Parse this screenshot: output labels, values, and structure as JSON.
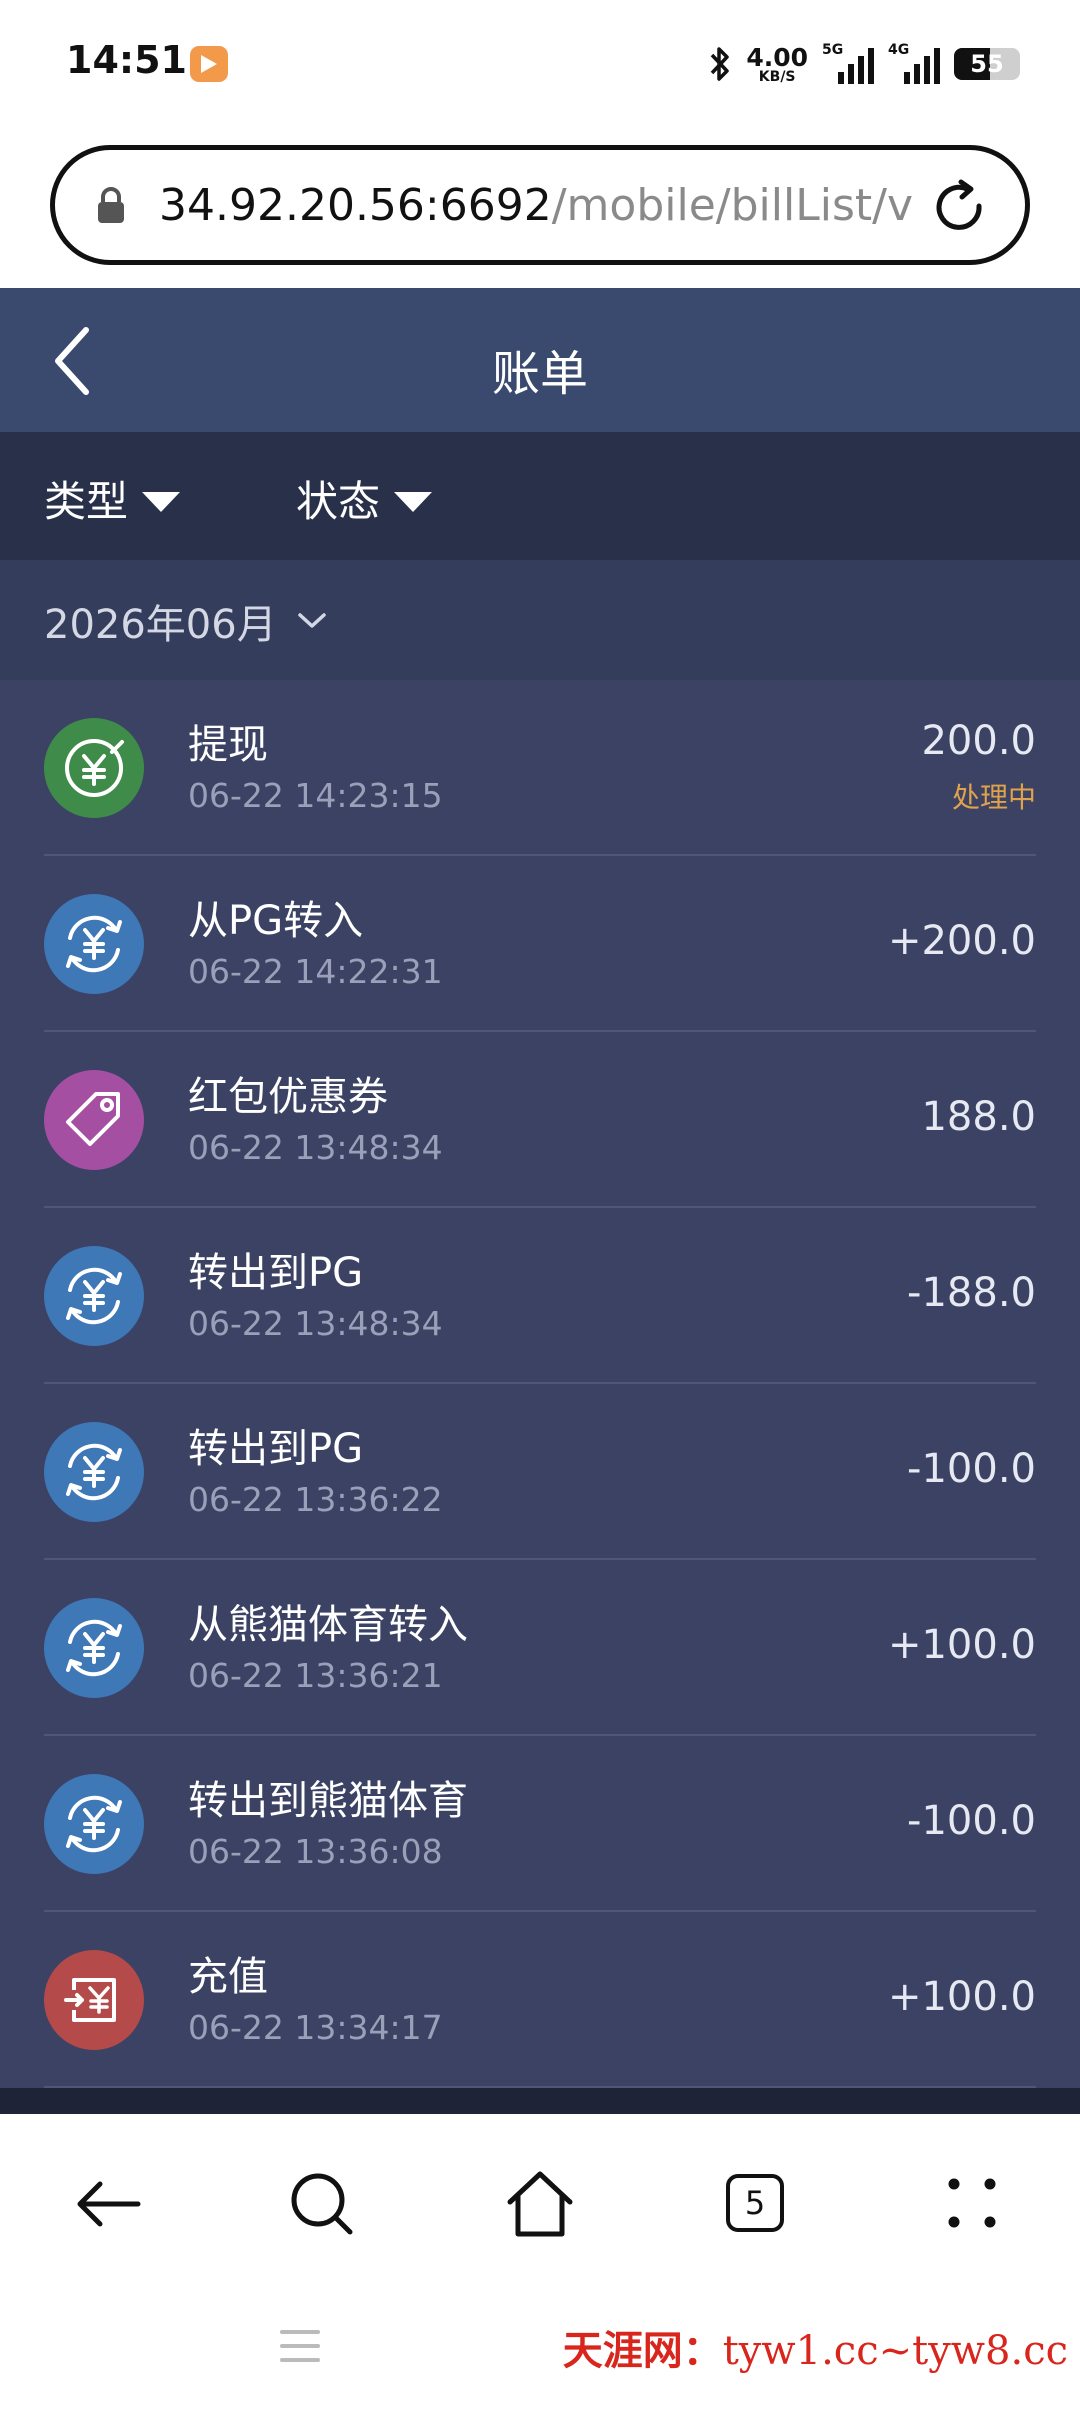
{
  "status_bar": {
    "time": "14:51",
    "net_speed_value": "4.00",
    "net_speed_unit": "KB/S",
    "signal1_tag": "5G",
    "signal2_tag": "4G",
    "battery": "55",
    "icons": [
      "bluetooth-icon",
      "signal-5g-icon",
      "signal-4g-icon",
      "battery-icon",
      "app-icon"
    ]
  },
  "browser": {
    "url_host": "34.92.20.56:6692",
    "url_path": "/mobile/billList/v",
    "tabs_count": "5"
  },
  "header": {
    "title": "账单"
  },
  "filters": {
    "type_label": "类型",
    "status_label": "状态"
  },
  "month": {
    "label": "2026年06月"
  },
  "bills": [
    {
      "name": "提现",
      "time": "06-22 14:23:15",
      "amount": "200.0",
      "status": "处理中",
      "icon": "withdraw-icon",
      "color": "#3f8c4a"
    },
    {
      "name": "从PG转入",
      "time": "06-22 14:22:31",
      "amount": "+200.0",
      "icon": "transfer-icon",
      "color": "#3e78b6"
    },
    {
      "name": "红包优惠券",
      "time": "06-22 13:48:34",
      "amount": "188.0",
      "icon": "coupon-tag-icon",
      "color": "#a54fa3"
    },
    {
      "name": "转出到PG",
      "time": "06-22 13:48:34",
      "amount": "-188.0",
      "icon": "transfer-icon",
      "color": "#3e78b6"
    },
    {
      "name": "转出到PG",
      "time": "06-22 13:36:22",
      "amount": "-100.0",
      "icon": "transfer-icon",
      "color": "#3e78b6"
    },
    {
      "name": "从熊猫体育转入",
      "time": "06-22 13:36:21",
      "amount": "+100.0",
      "icon": "transfer-icon",
      "color": "#3e78b6"
    },
    {
      "name": "转出到熊猫体育",
      "time": "06-22 13:36:08",
      "amount": "-100.0",
      "icon": "transfer-icon",
      "color": "#3e78b6"
    },
    {
      "name": "充值",
      "time": "06-22 13:34:17",
      "amount": "+100.0",
      "icon": "deposit-icon",
      "color": "#b54a4a"
    }
  ],
  "watermark": {
    "cn": "天涯网：",
    "en": "tyw1.cc~tyw8.cc"
  }
}
